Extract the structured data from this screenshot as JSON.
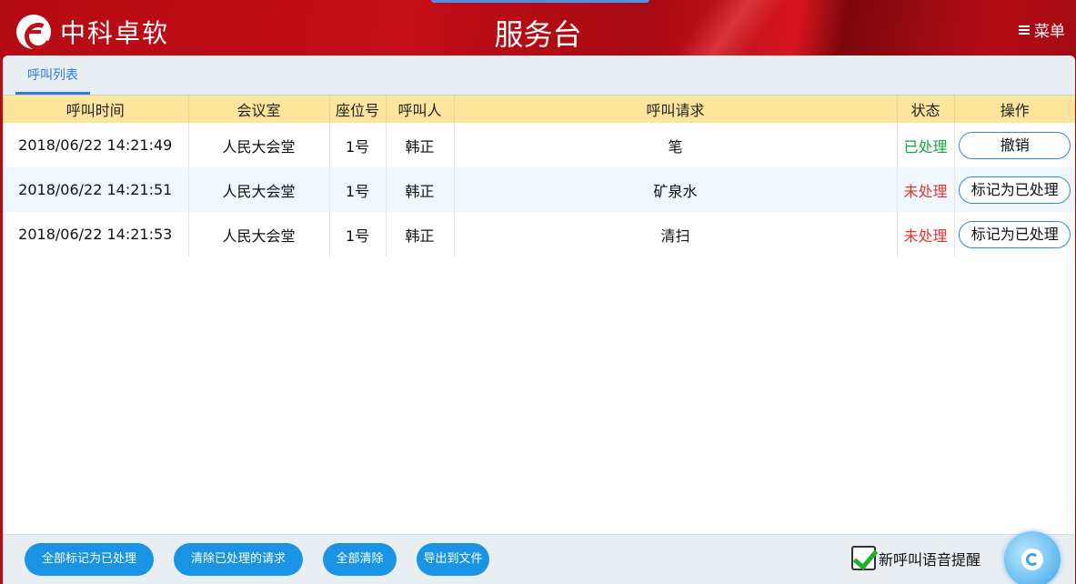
{
  "header": {
    "logo_text": "中科卓软",
    "title": "服务台",
    "menu_label": "菜单"
  },
  "tabs": [
    {
      "label": "呼叫列表",
      "active": true
    }
  ],
  "table": {
    "columns": [
      "呼叫时间",
      "会议室",
      "座位号",
      "呼叫人",
      "呼叫请求",
      "状态",
      "操作"
    ],
    "rows": [
      {
        "time": "2018/06/22 14:21:49",
        "room": "人民大会堂",
        "seat": "1号",
        "caller": "韩正",
        "request": "笔",
        "status": "已处理",
        "status_color": "#1aa640",
        "action": "撤销"
      },
      {
        "time": "2018/06/22 14:21:51",
        "room": "人民大会堂",
        "seat": "1号",
        "caller": "韩正",
        "request": "矿泉水",
        "status": "未处理",
        "status_color": "#e5342f",
        "action": "标记为已处理"
      },
      {
        "time": "2018/06/22 14:21:53",
        "room": "人民大会堂",
        "seat": "1号",
        "caller": "韩正",
        "request": "清扫",
        "status": "未处理",
        "status_color": "#e5342f",
        "action": "标记为已处理"
      }
    ]
  },
  "footer": {
    "mark_all_label": "全部标记为已处理",
    "clear_processed_label": "清除已处理的请求",
    "clear_all_label": "全部清除",
    "export_label": "导出到文件",
    "voice_alert_label": "新呼叫语音提醒",
    "voice_alert_checked": true
  },
  "colors": {
    "header_red": "#c40d18",
    "accent_blue": "#1a95e6",
    "table_header": "#fde69b"
  }
}
